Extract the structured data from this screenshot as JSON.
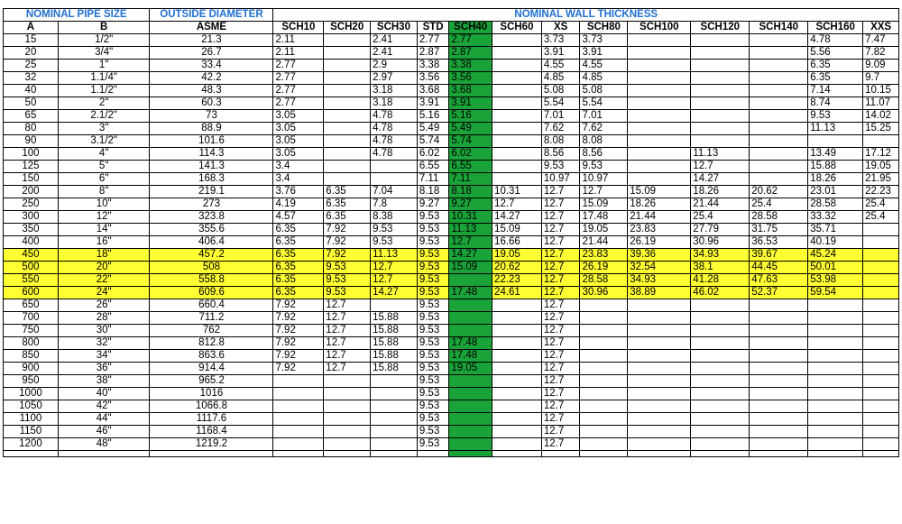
{
  "header": {
    "groups": {
      "nominal_pipe_size": "NOMINAL PIPE SIZE",
      "outside_diameter": "OUTSIDE DIAMETER",
      "nominal_wall_thickness": "NOMINAL WALL THICKNESS"
    },
    "columns": [
      "A",
      "B",
      "ASME",
      "SCH10",
      "SCH20",
      "SCH30",
      "STD",
      "SCH40",
      "SCH60",
      "XS",
      "SCH80",
      "SCH100",
      "SCH120",
      "SCH140",
      "SCH160",
      "XXS"
    ]
  },
  "colors": {
    "header_text": "#1f6fd1",
    "sch40_highlight": "#19a339",
    "row_highlight": "#ffff33"
  },
  "rows": [
    {
      "cells": [
        "15",
        "1/2\"",
        "21.3",
        "2.11",
        "",
        "2.41",
        "2.77",
        "2.77",
        "",
        "3.73",
        "3.73",
        "",
        "",
        "",
        "4.78",
        "7.47"
      ],
      "highlight": false
    },
    {
      "cells": [
        "20",
        "3/4\"",
        "26.7",
        "2.11",
        "",
        "2.41",
        "2.87",
        "2.87",
        "",
        "3.91",
        "3.91",
        "",
        "",
        "",
        "5.56",
        "7.82"
      ],
      "highlight": false
    },
    {
      "cells": [
        "25",
        "1\"",
        "33.4",
        "2.77",
        "",
        "2.9",
        "3.38",
        "3.38",
        "",
        "4.55",
        "4.55",
        "",
        "",
        "",
        "6.35",
        "9.09"
      ],
      "highlight": false
    },
    {
      "cells": [
        "32",
        "1.1/4\"",
        "42.2",
        "2.77",
        "",
        "2.97",
        "3.56",
        "3.56",
        "",
        "4.85",
        "4.85",
        "",
        "",
        "",
        "6.35",
        "9.7"
      ],
      "highlight": false
    },
    {
      "cells": [
        "40",
        "1.1/2\"",
        "48.3",
        "2.77",
        "",
        "3.18",
        "3.68",
        "3.68",
        "",
        "5.08",
        "5.08",
        "",
        "",
        "",
        "7.14",
        "10.15"
      ],
      "highlight": false
    },
    {
      "cells": [
        "50",
        "2\"",
        "60.3",
        "2.77",
        "",
        "3.18",
        "3.91",
        "3.91",
        "",
        "5.54",
        "5.54",
        "",
        "",
        "",
        "8.74",
        "11.07"
      ],
      "highlight": false
    },
    {
      "cells": [
        "65",
        "2.1/2\"",
        "73",
        "3.05",
        "",
        "4.78",
        "5.16",
        "5.16",
        "",
        "7.01",
        "7.01",
        "",
        "",
        "",
        "9.53",
        "14.02"
      ],
      "highlight": false
    },
    {
      "cells": [
        "80",
        "3\"",
        "88.9",
        "3.05",
        "",
        "4.78",
        "5.49",
        "5.49",
        "",
        "7.62",
        "7.62",
        "",
        "",
        "",
        "11.13",
        "15.25"
      ],
      "highlight": false
    },
    {
      "cells": [
        "90",
        "3.1/2\"",
        "101.6",
        "3.05",
        "",
        "4.78",
        "5.74",
        "5.74",
        "",
        "8.08",
        "8.08",
        "",
        "",
        "",
        "",
        ""
      ],
      "highlight": false
    },
    {
      "cells": [
        "100",
        "4\"",
        "114.3",
        "3.05",
        "",
        "4.78",
        "6.02",
        "6.02",
        "",
        "8.56",
        "8.56",
        "",
        "11.13",
        "",
        "13.49",
        "17.12"
      ],
      "highlight": false
    },
    {
      "cells": [
        "125",
        "5\"",
        "141.3",
        "3.4",
        "",
        "",
        "6.55",
        "6.55",
        "",
        "9.53",
        "9.53",
        "",
        "12.7",
        "",
        "15.88",
        "19.05"
      ],
      "highlight": false
    },
    {
      "cells": [
        "150",
        "6\"",
        "168.3",
        "3.4",
        "",
        "",
        "7.11",
        "7.11",
        "",
        "10.97",
        "10.97",
        "",
        "14.27",
        "",
        "18.26",
        "21.95"
      ],
      "highlight": false
    },
    {
      "cells": [
        "200",
        "8\"",
        "219.1",
        "3.76",
        "6.35",
        "7.04",
        "8.18",
        "8.18",
        "10.31",
        "12.7",
        "12.7",
        "15.09",
        "18.26",
        "20.62",
        "23.01",
        "22.23"
      ],
      "highlight": false
    },
    {
      "cells": [
        "250",
        "10\"",
        "273",
        "4.19",
        "6.35",
        "7.8",
        "9.27",
        "9.27",
        "12.7",
        "12.7",
        "15.09",
        "18.26",
        "21.44",
        "25.4",
        "28.58",
        "25.4"
      ],
      "highlight": false
    },
    {
      "cells": [
        "300",
        "12\"",
        "323.8",
        "4.57",
        "6.35",
        "8.38",
        "9.53",
        "10.31",
        "14.27",
        "12.7",
        "17.48",
        "21.44",
        "25.4",
        "28.58",
        "33.32",
        "25.4"
      ],
      "highlight": false
    },
    {
      "cells": [
        "350",
        "14\"",
        "355.6",
        "6.35",
        "7.92",
        "9.53",
        "9.53",
        "11.13",
        "15.09",
        "12.7",
        "19.05",
        "23.83",
        "27.79",
        "31.75",
        "35.71",
        ""
      ],
      "highlight": false
    },
    {
      "cells": [
        "400",
        "16\"",
        "406.4",
        "6.35",
        "7.92",
        "9.53",
        "9.53",
        "12.7",
        "16.66",
        "12.7",
        "21.44",
        "26.19",
        "30.96",
        "36.53",
        "40.19",
        ""
      ],
      "highlight": false
    },
    {
      "cells": [
        "450",
        "18\"",
        "457.2",
        "6.35",
        "7.92",
        "11.13",
        "9.53",
        "14.27",
        "19.05",
        "12.7",
        "23.83",
        "39.36",
        "34.93",
        "39.67",
        "45.24",
        ""
      ],
      "highlight": true
    },
    {
      "cells": [
        "500",
        "20\"",
        "508",
        "6.35",
        "9.53",
        "12.7",
        "9.53",
        "15.09",
        "20.62",
        "12.7",
        "26.19",
        "32.54",
        "38.1",
        "44.45",
        "50.01",
        ""
      ],
      "highlight": true
    },
    {
      "cells": [
        "550",
        "22\"",
        "558.8",
        "6.35",
        "9.53",
        "12.7",
        "9.53",
        "",
        "22.23",
        "12.7",
        "28.58",
        "34.93",
        "41.28",
        "47.63",
        "53.98",
        ""
      ],
      "highlight": true
    },
    {
      "cells": [
        "600",
        "24\"",
        "609.6",
        "6.35",
        "9.53",
        "14.27",
        "9.53",
        "17.48",
        "24.61",
        "12.7",
        "30.96",
        "38.89",
        "46.02",
        "52.37",
        "59.54",
        ""
      ],
      "highlight": true
    },
    {
      "cells": [
        "650",
        "26\"",
        "660.4",
        "7.92",
        "12.7",
        "",
        "9.53",
        "",
        "",
        "12.7",
        "",
        "",
        "",
        "",
        "",
        ""
      ],
      "highlight": false
    },
    {
      "cells": [
        "700",
        "28\"",
        "711.2",
        "7.92",
        "12.7",
        "15.88",
        "9.53",
        "",
        "",
        "12.7",
        "",
        "",
        "",
        "",
        "",
        ""
      ],
      "highlight": false
    },
    {
      "cells": [
        "750",
        "30\"",
        "762",
        "7.92",
        "12.7",
        "15.88",
        "9.53",
        "",
        "",
        "12.7",
        "",
        "",
        "",
        "",
        "",
        ""
      ],
      "highlight": false
    },
    {
      "cells": [
        "800",
        "32\"",
        "812.8",
        "7.92",
        "12.7",
        "15.88",
        "9.53",
        "17.48",
        "",
        "12.7",
        "",
        "",
        "",
        "",
        "",
        ""
      ],
      "highlight": false
    },
    {
      "cells": [
        "850",
        "34\"",
        "863.6",
        "7.92",
        "12.7",
        "15.88",
        "9.53",
        "17.48",
        "",
        "12.7",
        "",
        "",
        "",
        "",
        "",
        ""
      ],
      "highlight": false
    },
    {
      "cells": [
        "900",
        "36\"",
        "914.4",
        "7.92",
        "12.7",
        "15.88",
        "9.53",
        "19.05",
        "",
        "12.7",
        "",
        "",
        "",
        "",
        "",
        ""
      ],
      "highlight": false
    },
    {
      "cells": [
        "950",
        "38\"",
        "965.2",
        "",
        "",
        "",
        "9.53",
        "",
        "",
        "12.7",
        "",
        "",
        "",
        "",
        "",
        ""
      ],
      "highlight": false
    },
    {
      "cells": [
        "1000",
        "40\"",
        "1016",
        "",
        "",
        "",
        "9.53",
        "",
        "",
        "12.7",
        "",
        "",
        "",
        "",
        "",
        ""
      ],
      "highlight": false
    },
    {
      "cells": [
        "1050",
        "42\"",
        "1066.8",
        "",
        "",
        "",
        "9.53",
        "",
        "",
        "12.7",
        "",
        "",
        "",
        "",
        "",
        ""
      ],
      "highlight": false
    },
    {
      "cells": [
        "1100",
        "44\"",
        "1117.6",
        "",
        "",
        "",
        "9.53",
        "",
        "",
        "12.7",
        "",
        "",
        "",
        "",
        "",
        ""
      ],
      "highlight": false
    },
    {
      "cells": [
        "1150",
        "46\"",
        "1168.4",
        "",
        "",
        "",
        "9.53",
        "",
        "",
        "12.7",
        "",
        "",
        "",
        "",
        "",
        ""
      ],
      "highlight": false
    },
    {
      "cells": [
        "1200",
        "48\"",
        "1219.2",
        "",
        "",
        "",
        "9.53",
        "",
        "",
        "12.7",
        "",
        "",
        "",
        "",
        "",
        ""
      ],
      "highlight": false
    }
  ]
}
